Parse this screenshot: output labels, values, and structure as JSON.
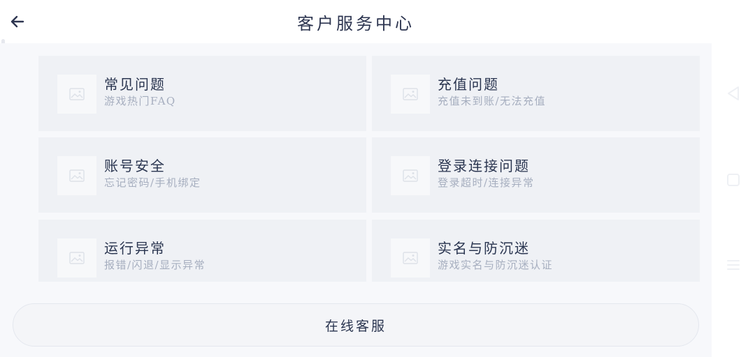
{
  "header": {
    "title": "客户服务中心",
    "back_icon": "arrow-left-icon"
  },
  "categories": [
    {
      "title": "常见问题",
      "subtitle": "游戏热门FAQ",
      "icon": "image-placeholder-icon"
    },
    {
      "title": "充值问题",
      "subtitle": "充值未到账/无法充值",
      "icon": "image-placeholder-icon"
    },
    {
      "title": "账号安全",
      "subtitle": "忘记密码/手机绑定",
      "icon": "image-placeholder-icon"
    },
    {
      "title": "登录连接问题",
      "subtitle": "登录超时/连接异常",
      "icon": "image-placeholder-icon"
    },
    {
      "title": "运行异常",
      "subtitle": "报错/闪退/显示异常",
      "icon": "image-placeholder-icon"
    },
    {
      "title": "实名与防沉迷",
      "subtitle": "游戏实名与防沉迷认证",
      "icon": "image-placeholder-icon"
    }
  ],
  "online_service": {
    "label": "在线客服"
  },
  "system_nav": {
    "back_icon": "triangle-back-icon",
    "home_icon": "square-home-icon",
    "menu_icon": "hamburger-menu-icon"
  },
  "colors": {
    "content_bg": "#f7f8fb",
    "card_bg": "#eff1f5",
    "title_text": "#2a3550",
    "subtitle_text": "#a6aebf"
  }
}
